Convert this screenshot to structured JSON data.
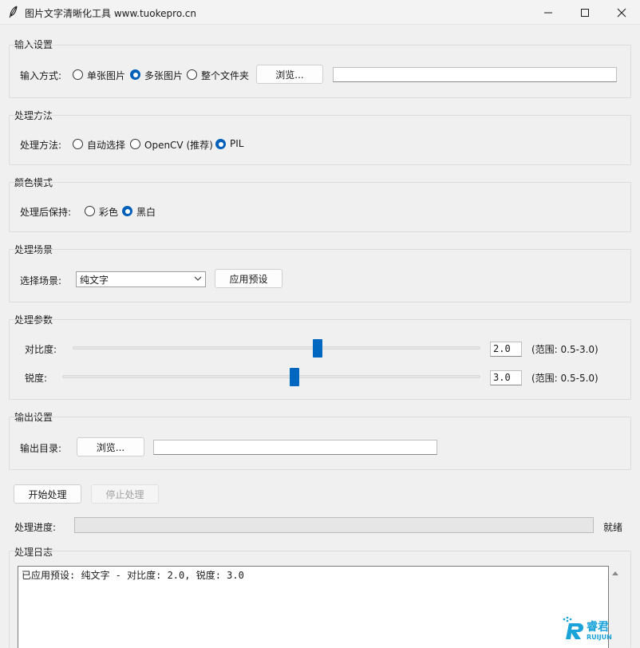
{
  "window": {
    "title": "图片文字清晰化工具 www.tuokepro.cn"
  },
  "input_settings": {
    "group_label": "输入设置",
    "mode_label": "输入方式:",
    "options": [
      "单张图片",
      "多张图片",
      "整个文件夹"
    ],
    "selected_index": 1,
    "browse_label": "浏览...",
    "path_value": ""
  },
  "method": {
    "group_label": "处理方法",
    "mode_label": "处理方法:",
    "options": [
      "自动选择",
      "OpenCV (推荐)",
      "PIL"
    ],
    "selected_index": 2
  },
  "color_mode": {
    "group_label": "颜色模式",
    "mode_label": "处理后保持:",
    "options": [
      "彩色",
      "黑白"
    ],
    "selected_index": 1
  },
  "scene": {
    "group_label": "处理场景",
    "mode_label": "选择场景:",
    "selected": "纯文字",
    "apply_label": "应用预设"
  },
  "params": {
    "group_label": "处理参数",
    "contrast": {
      "label": "对比度:",
      "value": "2.0",
      "range": "(范围: 0.5-3.0)",
      "fraction": 0.6
    },
    "sharpness": {
      "label": "锐度:",
      "value": "3.0",
      "range": "(范围: 0.5-5.0)",
      "fraction": 0.5556
    }
  },
  "output": {
    "group_label": "输出设置",
    "dir_label": "输出目录:",
    "browse_label": "浏览...",
    "path_value": ""
  },
  "actions": {
    "start_label": "开始处理",
    "stop_label": "停止处理"
  },
  "progress": {
    "label": "处理进度:",
    "value": 0,
    "status": "就绪"
  },
  "log": {
    "group_label": "处理日志",
    "lines": [
      "已应用预设: 纯文字 - 对比度: 2.0, 锐度: 3.0"
    ]
  },
  "watermark": {
    "brand_cn": "睿君",
    "brand_en": "RUIJUN",
    "colors": {
      "primary": "#1aa3d9",
      "accent": "#0067c0"
    }
  }
}
